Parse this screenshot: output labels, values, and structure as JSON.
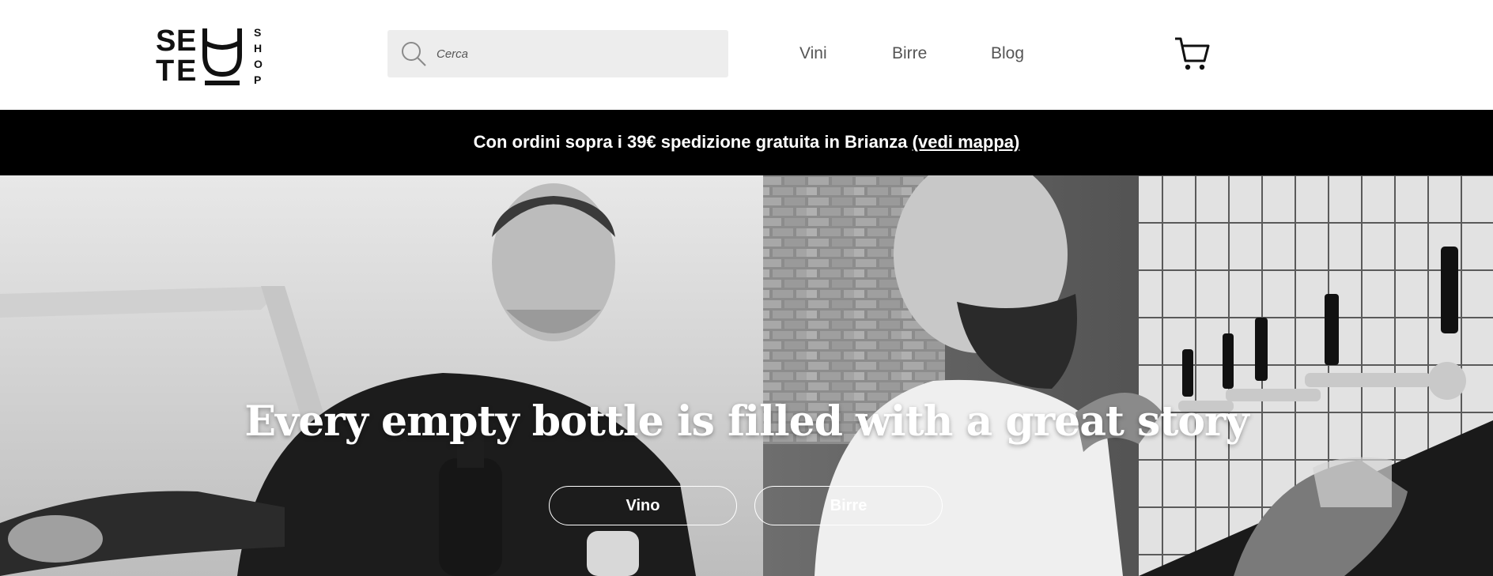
{
  "brand": {
    "logo_letters": [
      "S",
      "E",
      "T",
      "E"
    ],
    "logo_shop": [
      "S",
      "H",
      "O",
      "P"
    ],
    "logo_icon": "glass-icon"
  },
  "search": {
    "placeholder": "Cerca",
    "value": "",
    "icon": "search-icon"
  },
  "nav": {
    "vini": "Vini",
    "birre": "Birre",
    "blog": "Blog"
  },
  "cart": {
    "icon": "cart-icon"
  },
  "promo": {
    "text": "Con ordini sopra i 39€ spedizione gratuita in Brianza",
    "link": "(vedi mappa)"
  },
  "hero": {
    "title": "Every empty bottle is filled with a great story",
    "buttons": {
      "vino": "Vino",
      "birre": "Birre"
    }
  },
  "colors": {
    "header_bg": "#ffffff",
    "promo_bg": "#000000",
    "search_bg": "#ededed",
    "nav_text": "#555555",
    "hero_text": "#ffffff"
  }
}
